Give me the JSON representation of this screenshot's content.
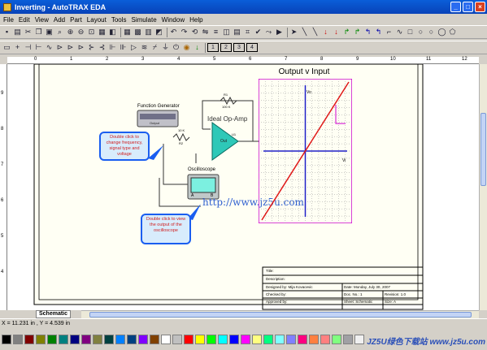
{
  "window": {
    "title": "Inverting - AutoTRAX EDA"
  },
  "menu": [
    "File",
    "Edit",
    "View",
    "Add",
    "Part",
    "Layout",
    "Tools",
    "Simulate",
    "Window",
    "Help"
  ],
  "rulers": {
    "top": [
      "0",
      "1",
      "2",
      "3",
      "4",
      "5",
      "6",
      "7",
      "8",
      "9",
      "10",
      "11",
      "12"
    ],
    "left": [
      "9",
      "8",
      "7",
      "6",
      "5",
      "4"
    ]
  },
  "schematic": {
    "function_generator_label": "Function Generator",
    "function_generator_sub": "Output",
    "oscilloscope_label": "Oscilloscope",
    "opamp_label": "Ideal Op-Amp",
    "opamp_out": "Out",
    "opamp_pin": "U1",
    "r1_name": "R1",
    "r1_value": "100 K",
    "r2_name": "R2",
    "r2_value": "10 K",
    "scope_a": "A",
    "scope_b": "B",
    "callout_generator": "Double click to change frequency, signal type and voltage",
    "callout_scope": "Double click to view the output of the oscilloscope",
    "url_text": "http://www.jz5u.com"
  },
  "plot": {
    "title": "Output v Input",
    "y_label": "Vo",
    "x_label": "Vi",
    "trace_color": "#e01818",
    "axis_color": "#2020c8",
    "frame_color": "#d000d0"
  },
  "title_block": {
    "title": "Title:",
    "description": "Description:",
    "designed_by": "Designed by: Mija Kovacevic",
    "date": "Date: Monday, July 30, 2007",
    "checked_by": "Checked by:",
    "doc_no": "Doc. No.: 1",
    "revision": "Revision: 1.0",
    "approved_by": "Approved by:",
    "sheet": "Sheet: Schematic",
    "size": "Size: A"
  },
  "tab": "Schematic",
  "status": "X = 11.231 in , Y = 4.539 in",
  "watermark": "JZ5U绿色下载站 www.jz5u.com",
  "palette": [
    "#000000",
    "#808080",
    "#800000",
    "#808000",
    "#008000",
    "#008080",
    "#000080",
    "#800080",
    "#808040",
    "#004040",
    "#0080ff",
    "#004080",
    "#8000ff",
    "#804000",
    "#ffffff",
    "#c0c0c0",
    "#ff0000",
    "#ffff00",
    "#00ff00",
    "#00ffff",
    "#0000ff",
    "#ff00ff",
    "#ffff80",
    "#00ff80",
    "#80ffff",
    "#8080ff",
    "#ff0080",
    "#ff8040",
    "#ff8080",
    "#80ff80",
    "#a0a0a4",
    "#f0f0f0"
  ]
}
